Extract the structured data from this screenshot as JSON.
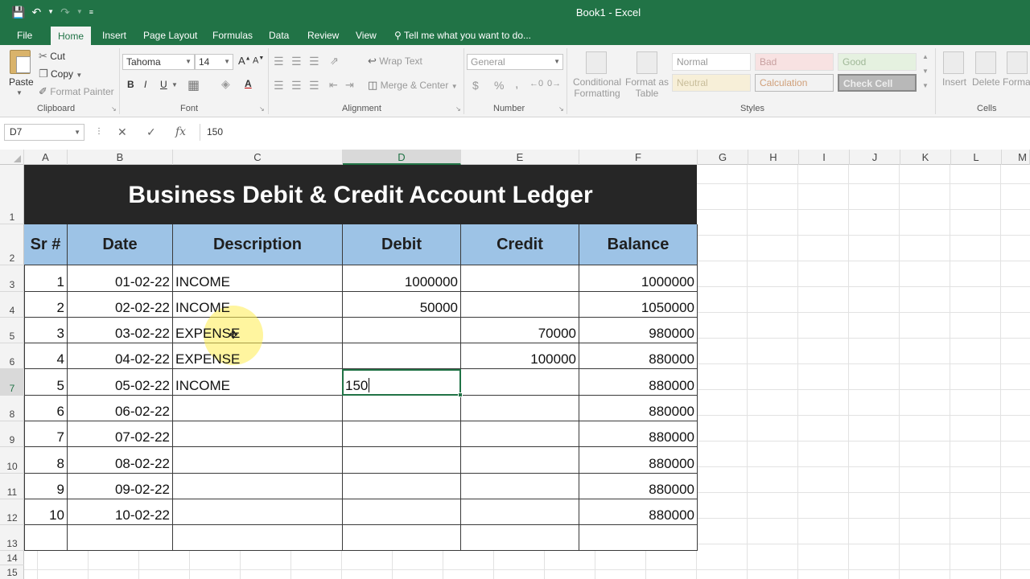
{
  "window": {
    "title": "Book1 - Excel"
  },
  "qat": {
    "save_icon": "save-icon",
    "undo_icon": "undo-icon",
    "redo_icon": "redo-icon"
  },
  "tabs": [
    {
      "label": "File"
    },
    {
      "label": "Home",
      "active": true
    },
    {
      "label": "Insert"
    },
    {
      "label": "Page Layout"
    },
    {
      "label": "Formulas"
    },
    {
      "label": "Data"
    },
    {
      "label": "Review"
    },
    {
      "label": "View"
    }
  ],
  "tell_me": "Tell me what you want to do...",
  "ribbon": {
    "clipboard": {
      "paste": "Paste",
      "cut": "Cut",
      "copy": "Copy",
      "format_painter": "Format Painter",
      "group": "Clipboard"
    },
    "font": {
      "name": "Tahoma",
      "size": "14",
      "bold": "B",
      "italic": "I",
      "underline": "U",
      "color_a": "A",
      "grow": "A",
      "shrink": "A",
      "group": "Font"
    },
    "alignment": {
      "wrap_text": "Wrap Text",
      "merge_center": "Merge & Center",
      "group": "Alignment"
    },
    "number": {
      "format": "General",
      "currency": "$",
      "percent": "%",
      "comma": ",",
      "group": "Number"
    },
    "styles": {
      "conditional": "Conditional",
      "conditional2": "Formatting",
      "format_as": "Format as",
      "format_as2": "Table",
      "normal": "Normal",
      "bad": "Bad",
      "good": "Good",
      "neutral": "Neutral",
      "calculation": "Calculation",
      "check_cell": "Check Cell",
      "group": "Styles"
    },
    "cells": {
      "insert": "Insert",
      "delete": "Delete",
      "format": "Forma",
      "group": "Cells"
    }
  },
  "formula_bar": {
    "name_box": "D7",
    "value": "150",
    "fx": "fx"
  },
  "columns": [
    "A",
    "B",
    "C",
    "D",
    "E",
    "F",
    "G",
    "H",
    "I",
    "J",
    "K",
    "L",
    "M"
  ],
  "rows": [
    "1",
    "2",
    "3",
    "4",
    "5",
    "6",
    "7",
    "8",
    "9",
    "10",
    "11",
    "12",
    "13",
    "14",
    "15"
  ],
  "ledger": {
    "title": "Business Debit & Credit Account Ledger",
    "headers": [
      "Sr #",
      "Date",
      "Description",
      "Debit",
      "Credit",
      "Balance"
    ],
    "rows": [
      {
        "sr": "1",
        "date": "01-02-22",
        "desc": "INCOME",
        "debit": "1000000",
        "credit": "",
        "balance": "1000000"
      },
      {
        "sr": "2",
        "date": "02-02-22",
        "desc": "INCOME",
        "debit": "50000",
        "credit": "",
        "balance": "1050000"
      },
      {
        "sr": "3",
        "date": "03-02-22",
        "desc": "EXPENSE",
        "debit": "",
        "credit": "70000",
        "balance": "980000"
      },
      {
        "sr": "4",
        "date": "04-02-22",
        "desc": "EXPENSE",
        "debit": "",
        "credit": "100000",
        "balance": "880000"
      },
      {
        "sr": "5",
        "date": "05-02-22",
        "desc": "INCOME",
        "debit": "150",
        "credit": "",
        "balance": "880000"
      },
      {
        "sr": "6",
        "date": "06-02-22",
        "desc": "",
        "debit": "",
        "credit": "",
        "balance": "880000"
      },
      {
        "sr": "7",
        "date": "07-02-22",
        "desc": "",
        "debit": "",
        "credit": "",
        "balance": "880000"
      },
      {
        "sr": "8",
        "date": "08-02-22",
        "desc": "",
        "debit": "",
        "credit": "",
        "balance": "880000"
      },
      {
        "sr": "9",
        "date": "09-02-22",
        "desc": "",
        "debit": "",
        "credit": "",
        "balance": "880000"
      },
      {
        "sr": "10",
        "date": "10-02-22",
        "desc": "",
        "debit": "",
        "credit": "",
        "balance": "880000"
      }
    ]
  },
  "colors": {
    "excel_green": "#217346",
    "header_blue": "#9dc3e6",
    "title_band": "#262626"
  }
}
